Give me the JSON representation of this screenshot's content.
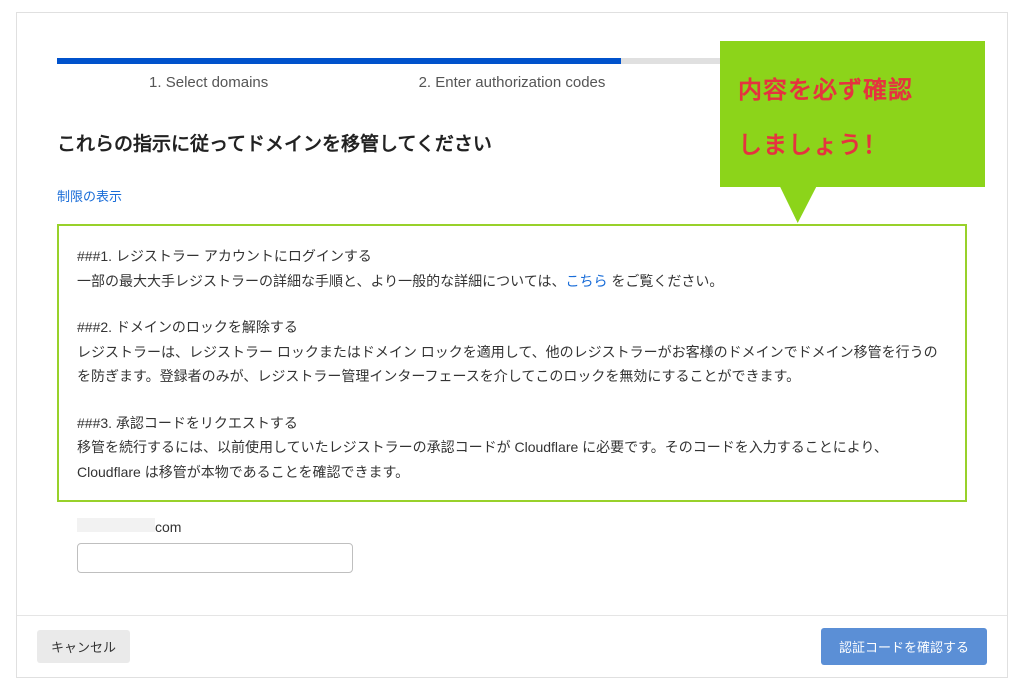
{
  "callout": {
    "line1": "内容を必ず確認",
    "line2": "しましょう！"
  },
  "steps": {
    "step1": "1. Select domains",
    "step2": "2. Enter authorization codes"
  },
  "heading": "これらの指示に従ってドメインを移管してください",
  "limits_link": "制限の表示",
  "instructions": {
    "block1_title": "###1.  レジストラー アカウントにログインする",
    "block1_body_a": "一部の最大大手レジストラーの詳細な手順と、より一般的な詳細については、",
    "block1_link": "こちら",
    "block1_body_b": " をご覧ください。",
    "block2_title": "###2.  ドメインのロックを解除する",
    "block2_body": "レジストラーは、レジストラー ロックまたはドメイン ロックを適用して、他のレジストラーがお客様のドメインでドメイン移管を行うのを防ぎます。登録者のみが、レジストラー管理インターフェースを介してこのロックを無効にすることができます。",
    "block3_title": "###3.  承認コードをリクエストする",
    "block3_body": "移管を続行するには、以前使用していたレジストラーの承認コードが Cloudflare に必要です。そのコードを入力することにより、Cloudflare は移管が本物であることを確認できます。"
  },
  "domain": {
    "suffix": "com"
  },
  "auth_input": {
    "value": ""
  },
  "buttons": {
    "cancel": "キャンセル",
    "confirm": "認証コードを確認する"
  }
}
